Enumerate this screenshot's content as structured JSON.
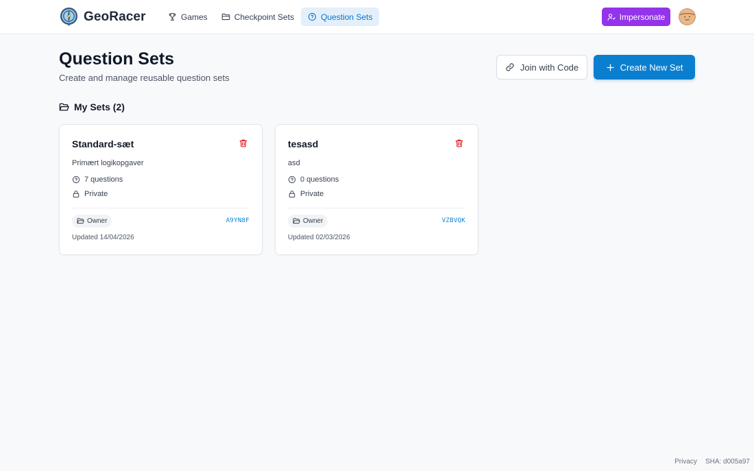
{
  "app": {
    "name": "GeoRacer",
    "logo_icon": "compass-pin-logo-icon"
  },
  "nav": {
    "items": [
      {
        "label": "Games",
        "icon": "trophy-icon",
        "active": false
      },
      {
        "label": "Checkpoint Sets",
        "icon": "folder-icon",
        "active": false
      },
      {
        "label": "Question Sets",
        "icon": "question-circle-icon",
        "active": true
      }
    ],
    "impersonate_label": "Impersonate"
  },
  "page": {
    "title": "Question Sets",
    "subtitle": "Create and manage reusable question sets",
    "join_label": "Join with Code",
    "create_label": "Create New Set"
  },
  "section": {
    "title": "My Sets (2)"
  },
  "cards": [
    {
      "title": "Standard-sæt",
      "description": "Primært logikopgaver",
      "questions": "7 questions",
      "visibility": "Private",
      "role": "Owner",
      "code": "A9YN8F",
      "updated": "Updated 14/04/2026"
    },
    {
      "title": "tesasd",
      "description": "asd",
      "questions": "0 questions",
      "visibility": "Private",
      "role": "Owner",
      "code": "VZBVQK",
      "updated": "Updated 02/03/2026"
    }
  ],
  "footer": {
    "privacy": "Privacy",
    "sha": "SHA: d005a97"
  },
  "colors": {
    "primary": "#0b7fcf",
    "impersonate": "#9333ea",
    "delete": "#dc2626",
    "nav_active_bg": "#e3f0fb"
  }
}
